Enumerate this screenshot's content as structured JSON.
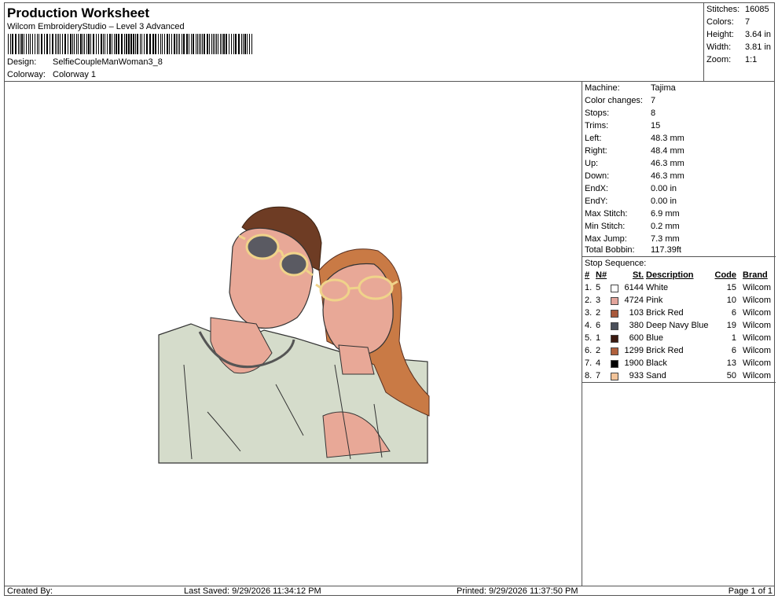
{
  "header": {
    "title": "Production Worksheet",
    "subtitle": "Wilcom EmbroideryStudio – Level 3 Advanced",
    "design_label": "Design:",
    "design_value": "SelfieCoupleManWoman3_8",
    "colorway_label": "Colorway:",
    "colorway_value": "Colorway 1"
  },
  "summary": [
    {
      "label": "Stitches:",
      "value": "16085"
    },
    {
      "label": "Colors:",
      "value": "7"
    },
    {
      "label": "Height:",
      "value": "3.64 in"
    },
    {
      "label": "Width:",
      "value": "3.81 in"
    },
    {
      "label": "Zoom:",
      "value": "1:1"
    }
  ],
  "specs": [
    {
      "label": "Machine:",
      "value": "Tajima"
    },
    {
      "label": "Color changes:",
      "value": "7"
    },
    {
      "label": "Stops:",
      "value": "8"
    },
    {
      "label": "Trims:",
      "value": "15"
    },
    {
      "label": "Left:",
      "value": "48.3 mm"
    },
    {
      "label": "Right:",
      "value": "48.4 mm"
    },
    {
      "label": "Up:",
      "value": "46.3 mm"
    },
    {
      "label": "Down:",
      "value": "46.3 mm"
    },
    {
      "label": "EndX:",
      "value": "0.00 in"
    },
    {
      "label": "EndY:",
      "value": "0.00 in"
    },
    {
      "label": "Max Stitch:",
      "value": "6.9 mm"
    },
    {
      "label": "Min Stitch:",
      "value": "0.2 mm"
    },
    {
      "label": "Max Jump:",
      "value": "7.3 mm"
    },
    {
      "label": "Total Bobbin:",
      "value": "117.39ft"
    }
  ],
  "stop_sequence": {
    "title": "Stop Sequence:",
    "headers": {
      "idx": "#",
      "n": "N#",
      "st": "St.",
      "desc": "Description",
      "code": "Code",
      "brand": "Brand"
    },
    "rows": [
      {
        "idx": "1.",
        "n": "5",
        "color": "#ffffff",
        "st": "6144",
        "desc": "White",
        "code": "15",
        "brand": "Wilcom"
      },
      {
        "idx": "2.",
        "n": "3",
        "color": "#e3a59c",
        "st": "4724",
        "desc": "Pink",
        "code": "10",
        "brand": "Wilcom"
      },
      {
        "idx": "3.",
        "n": "2",
        "color": "#a8593b",
        "st": "103",
        "desc": "Brick Red",
        "code": "6",
        "brand": "Wilcom"
      },
      {
        "idx": "4.",
        "n": "6",
        "color": "#4a4f5a",
        "st": "380",
        "desc": "Deep Navy Blue",
        "code": "19",
        "brand": "Wilcom"
      },
      {
        "idx": "5.",
        "n": "1",
        "color": "#3b1a10",
        "st": "600",
        "desc": "Blue",
        "code": "1",
        "brand": "Wilcom"
      },
      {
        "idx": "6.",
        "n": "2",
        "color": "#b0603c",
        "st": "1299",
        "desc": "Brick Red",
        "code": "6",
        "brand": "Wilcom"
      },
      {
        "idx": "7.",
        "n": "4",
        "color": "#000000",
        "st": "1900",
        "desc": "Black",
        "code": "13",
        "brand": "Wilcom"
      },
      {
        "idx": "8.",
        "n": "7",
        "color": "#f2c49a",
        "st": "933",
        "desc": "Sand",
        "code": "50",
        "brand": "Wilcom"
      }
    ]
  },
  "footer": {
    "created_by": "Created By:",
    "last_saved": "Last Saved: 9/29/2026 11:34:12 PM",
    "printed": "Printed: 9/29/2026 11:37:50 PM",
    "page": "Page 1 of 1"
  },
  "colors": {
    "shirt": "#d5dccb",
    "skin": "#e8a897",
    "hair_man": "#6e3c24",
    "hair_woman": "#c97a45",
    "glasses": "#f0d38a",
    "lens": "#5a5a62"
  }
}
